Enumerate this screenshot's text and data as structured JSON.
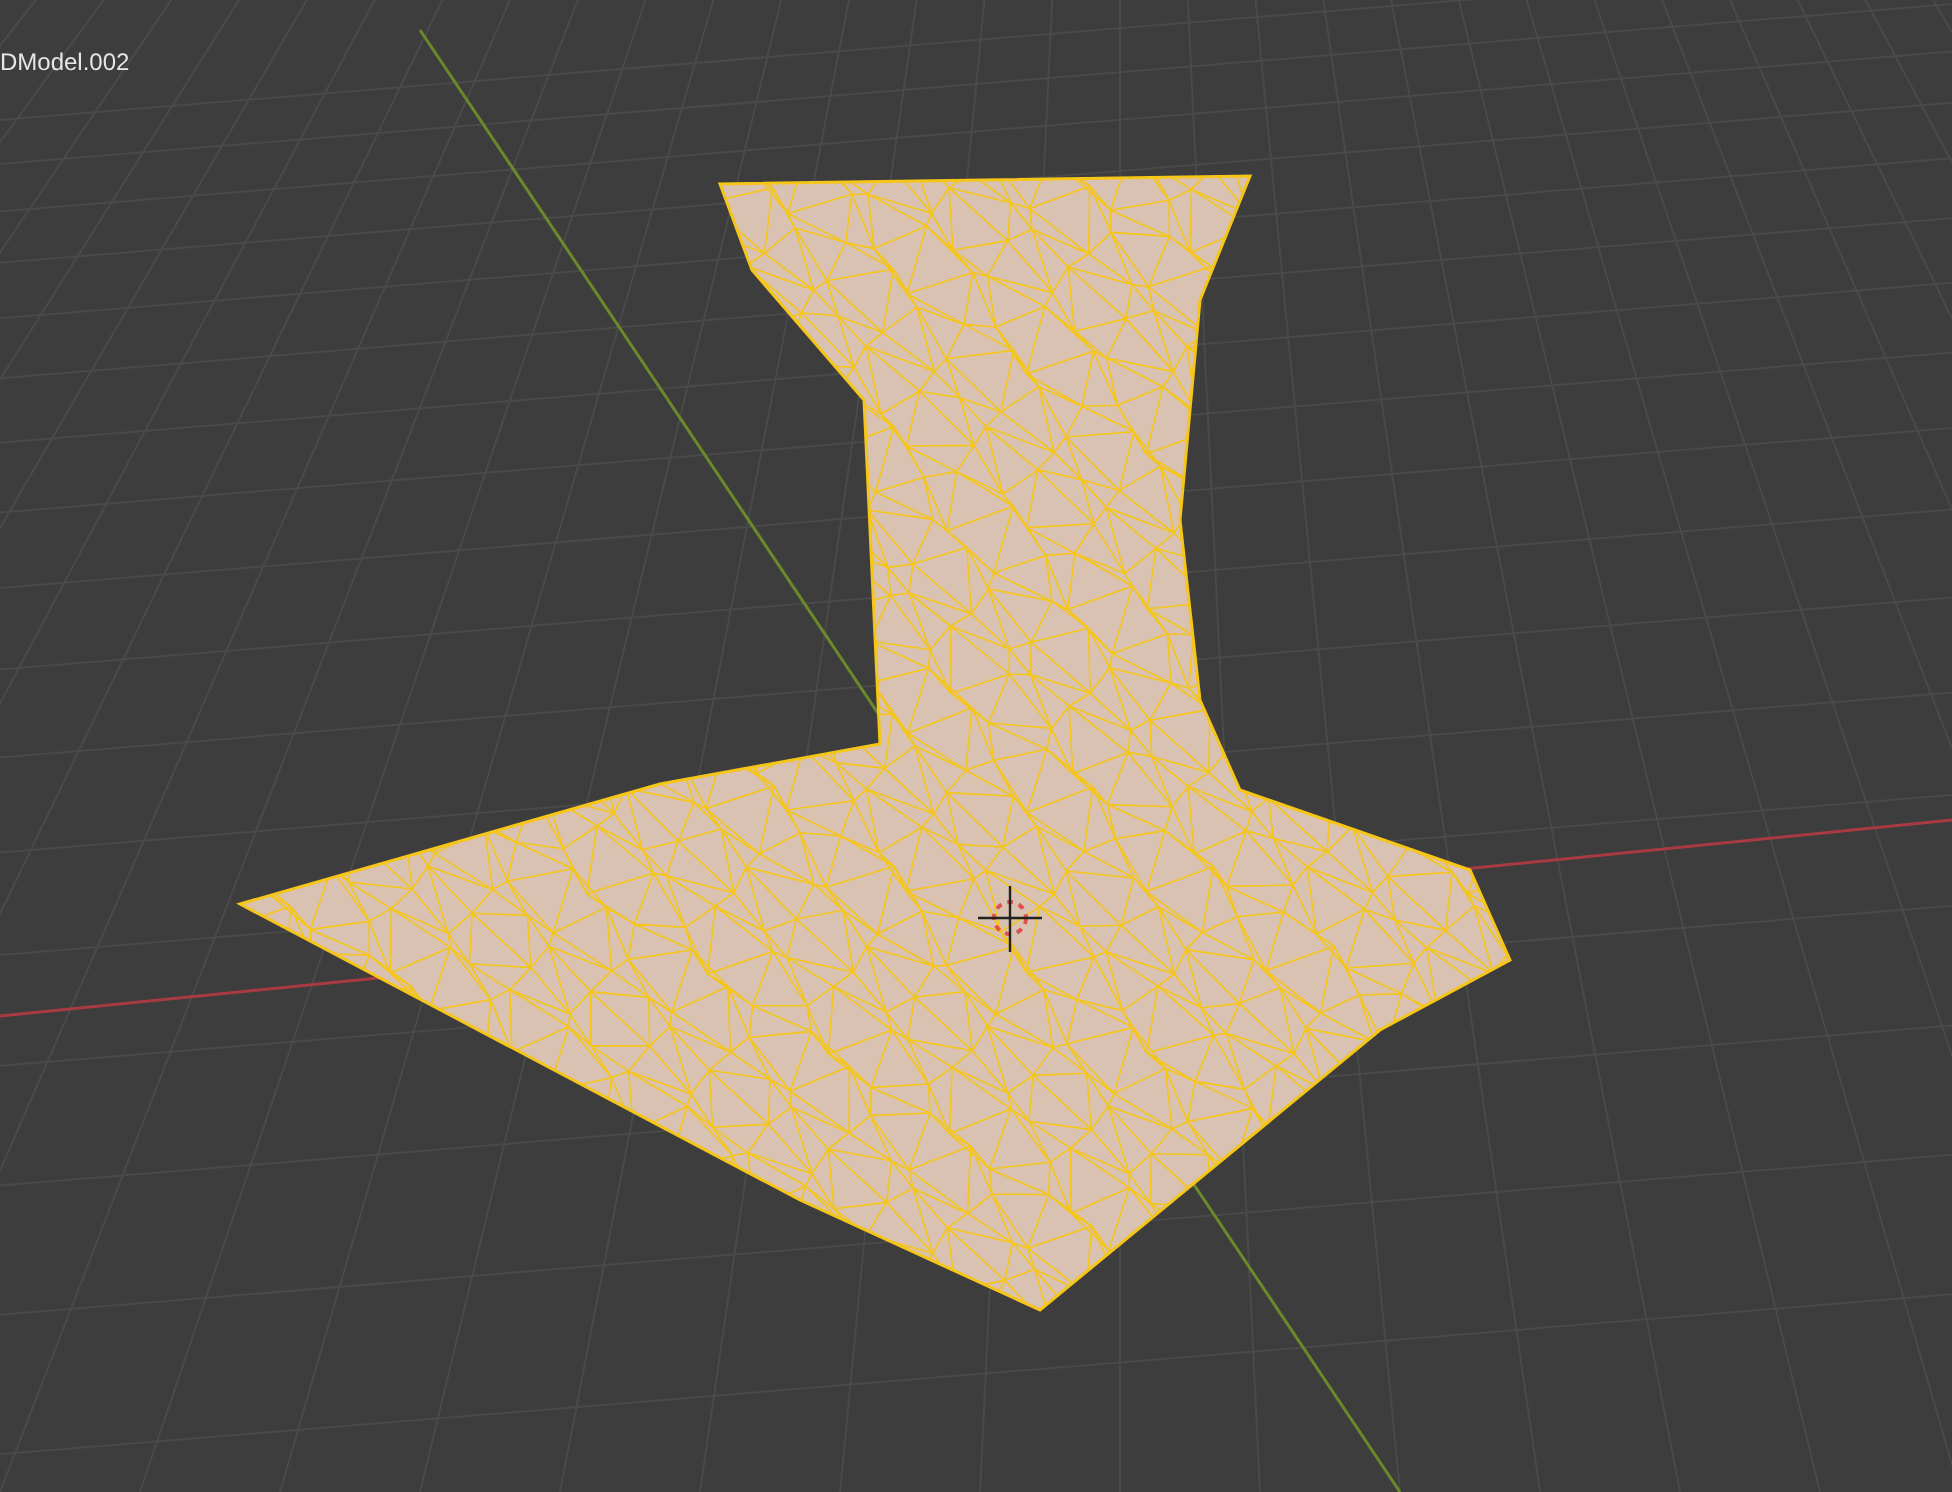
{
  "viewport": {
    "object_name": "DModel.002"
  }
}
